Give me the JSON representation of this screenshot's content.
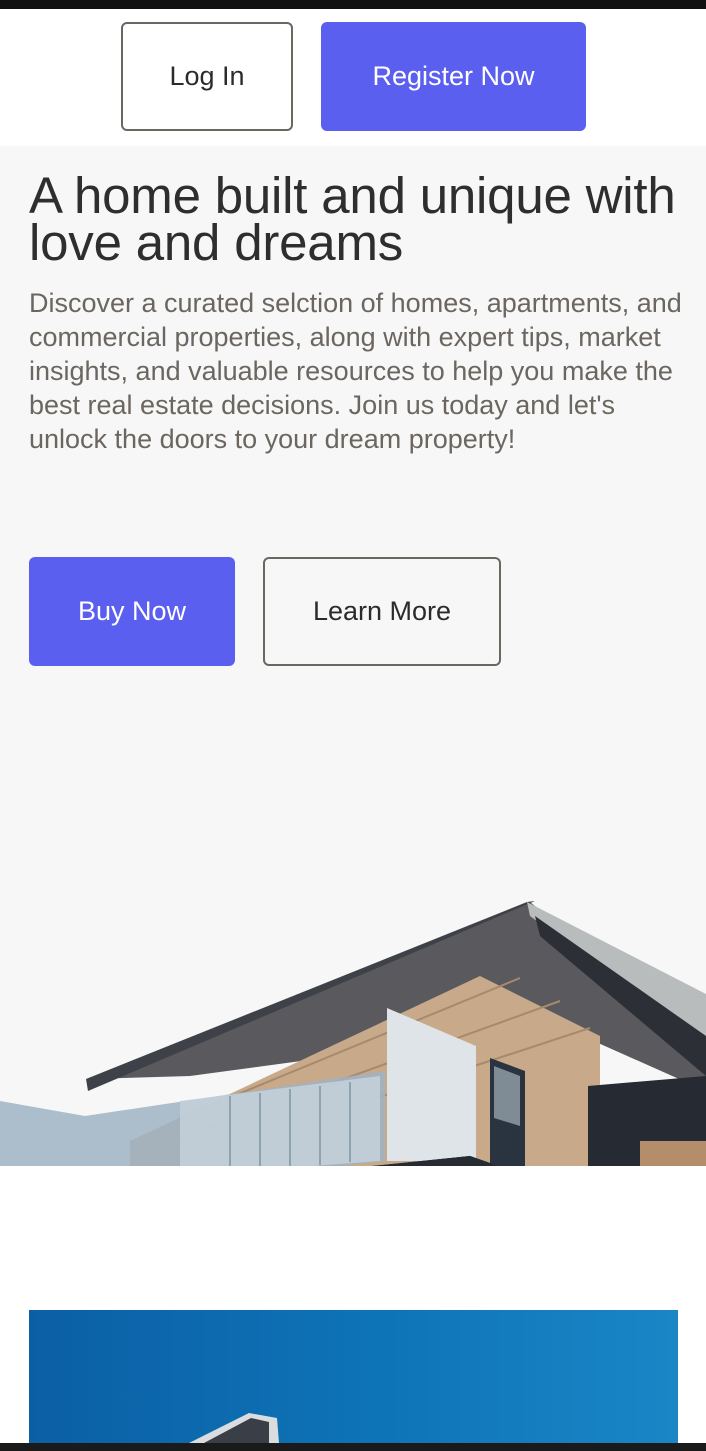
{
  "header": {
    "login_label": "Log In",
    "register_label": "Register Now"
  },
  "hero": {
    "headline": "A home built and unique with love and dreams",
    "description": "Discover a curated selction of homes, apartments, and commercial properties, along with expert tips, market insights, and valuable resources to help you make the best real estate decisions. Join us today and let's unlock the doors to your dream property!",
    "buy_label": "Buy Now",
    "learn_label": "Learn More"
  },
  "colors": {
    "accent": "#5b5fef",
    "text_dark": "#2e2e2e",
    "text_muted": "#6b6660",
    "hero_bg": "#f7f7f7"
  }
}
